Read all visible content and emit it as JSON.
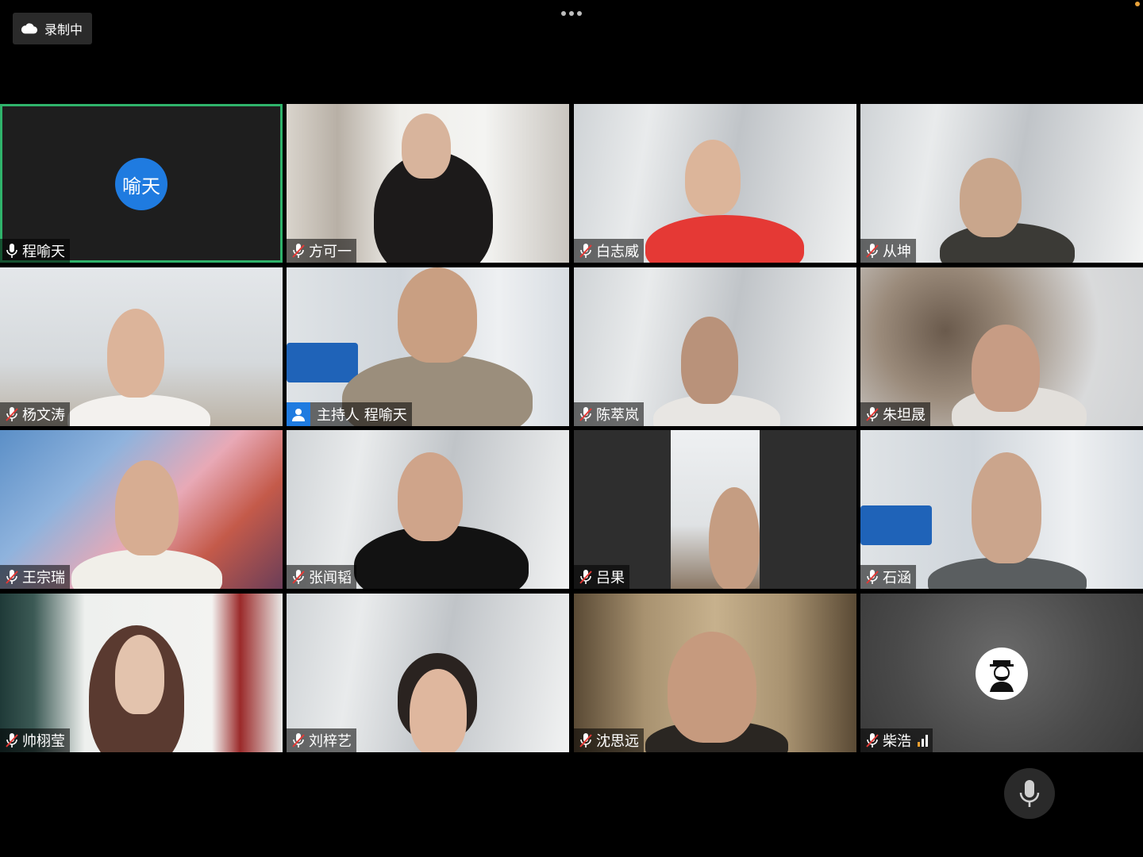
{
  "recording": {
    "label": "录制中"
  },
  "participants": [
    {
      "name": "程喻天",
      "avatar_text": "喻天",
      "muted": false,
      "active": true,
      "type": "avatar"
    },
    {
      "name": "方可一",
      "muted": true,
      "type": "video"
    },
    {
      "name": "白志威",
      "muted": true,
      "type": "video"
    },
    {
      "name": "从坤",
      "muted": true,
      "type": "video"
    },
    {
      "name": "杨文涛",
      "muted": true,
      "type": "video"
    },
    {
      "name": "主持人 程喻天",
      "muted": false,
      "host": true,
      "type": "video"
    },
    {
      "name": "陈萃岚",
      "muted": true,
      "type": "video"
    },
    {
      "name": "朱坦晟",
      "muted": true,
      "type": "video"
    },
    {
      "name": "王宗瑞",
      "muted": true,
      "type": "video"
    },
    {
      "name": "张闻韬",
      "muted": true,
      "type": "video"
    },
    {
      "name": "吕果",
      "muted": true,
      "type": "video"
    },
    {
      "name": "石涵",
      "muted": true,
      "type": "video"
    },
    {
      "name": "帅栩莹",
      "muted": true,
      "type": "video"
    },
    {
      "name": "刘梓艺",
      "muted": true,
      "type": "video"
    },
    {
      "name": "沈思远",
      "muted": true,
      "type": "video"
    },
    {
      "name": "柴浩",
      "muted": true,
      "type": "profile",
      "signal": true
    }
  ],
  "colors": {
    "active_border": "#2fb36b",
    "avatar_blue": "#1f7be0",
    "background": "#000000"
  },
  "icons": [
    "cloud-icon",
    "more-icon",
    "mic-icon",
    "mic-muted-icon",
    "host-icon",
    "signal-icon",
    "microphone-button-icon"
  ]
}
